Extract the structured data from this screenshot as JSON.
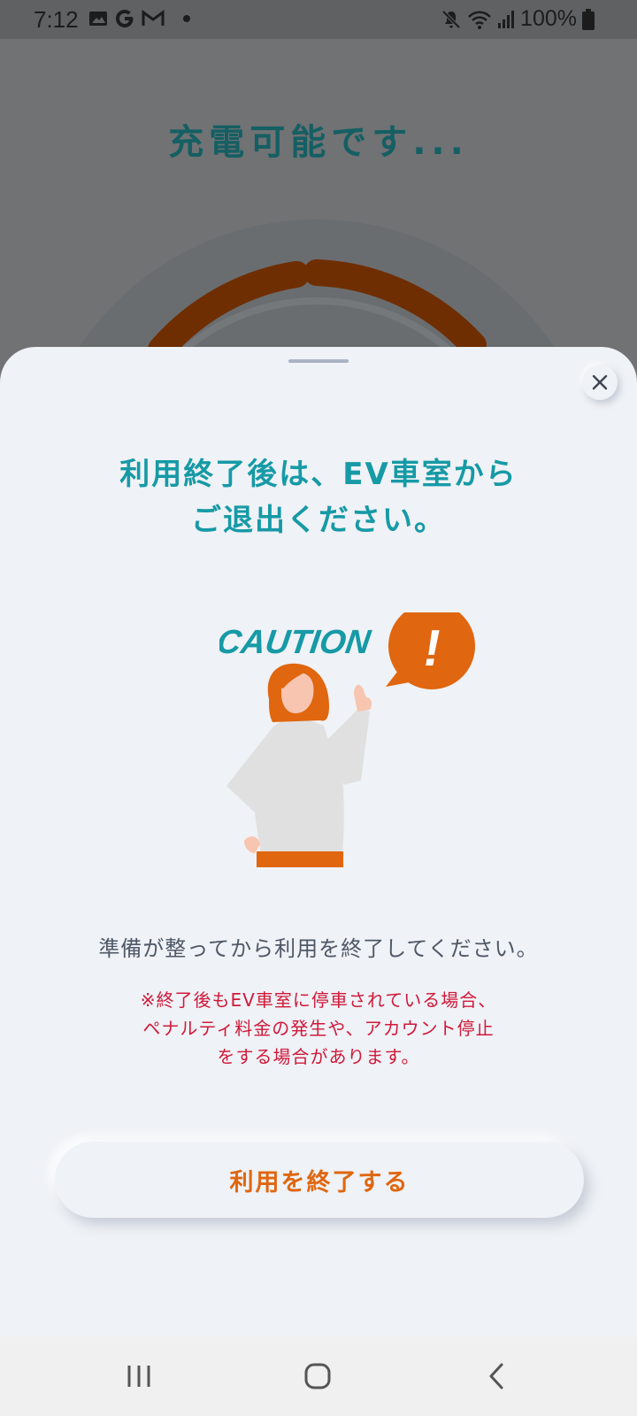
{
  "status_bar": {
    "time": "7:12",
    "battery": "100%",
    "icons": [
      "image-icon",
      "google-icon",
      "gmail-icon",
      "dot-icon",
      "mute-icon",
      "wifi-icon",
      "signal-icon",
      "battery-icon"
    ]
  },
  "background": {
    "title": "充電可能です..."
  },
  "sheet": {
    "title_line1": "利用終了後は、EV車室から",
    "title_line2": "ご退出ください。",
    "caution_label": "CAUTION",
    "caution_mark": "!",
    "body": "準備が整ってから利用を終了してください。",
    "warning_lines": [
      "※終了後もEV車室に停車されている場合、",
      "ペナルティ料金の発生や、アカウント停止",
      "をする場合があります。"
    ],
    "end_button_label": "利用を終了する"
  },
  "colors": {
    "accent_teal": "#169aa6",
    "accent_orange": "#e0660f",
    "warning_red": "#d1193a",
    "sheet_bg": "#eff2f6"
  },
  "nav_bar": {
    "icons": [
      "recents-icon",
      "home-icon",
      "back-icon"
    ]
  }
}
